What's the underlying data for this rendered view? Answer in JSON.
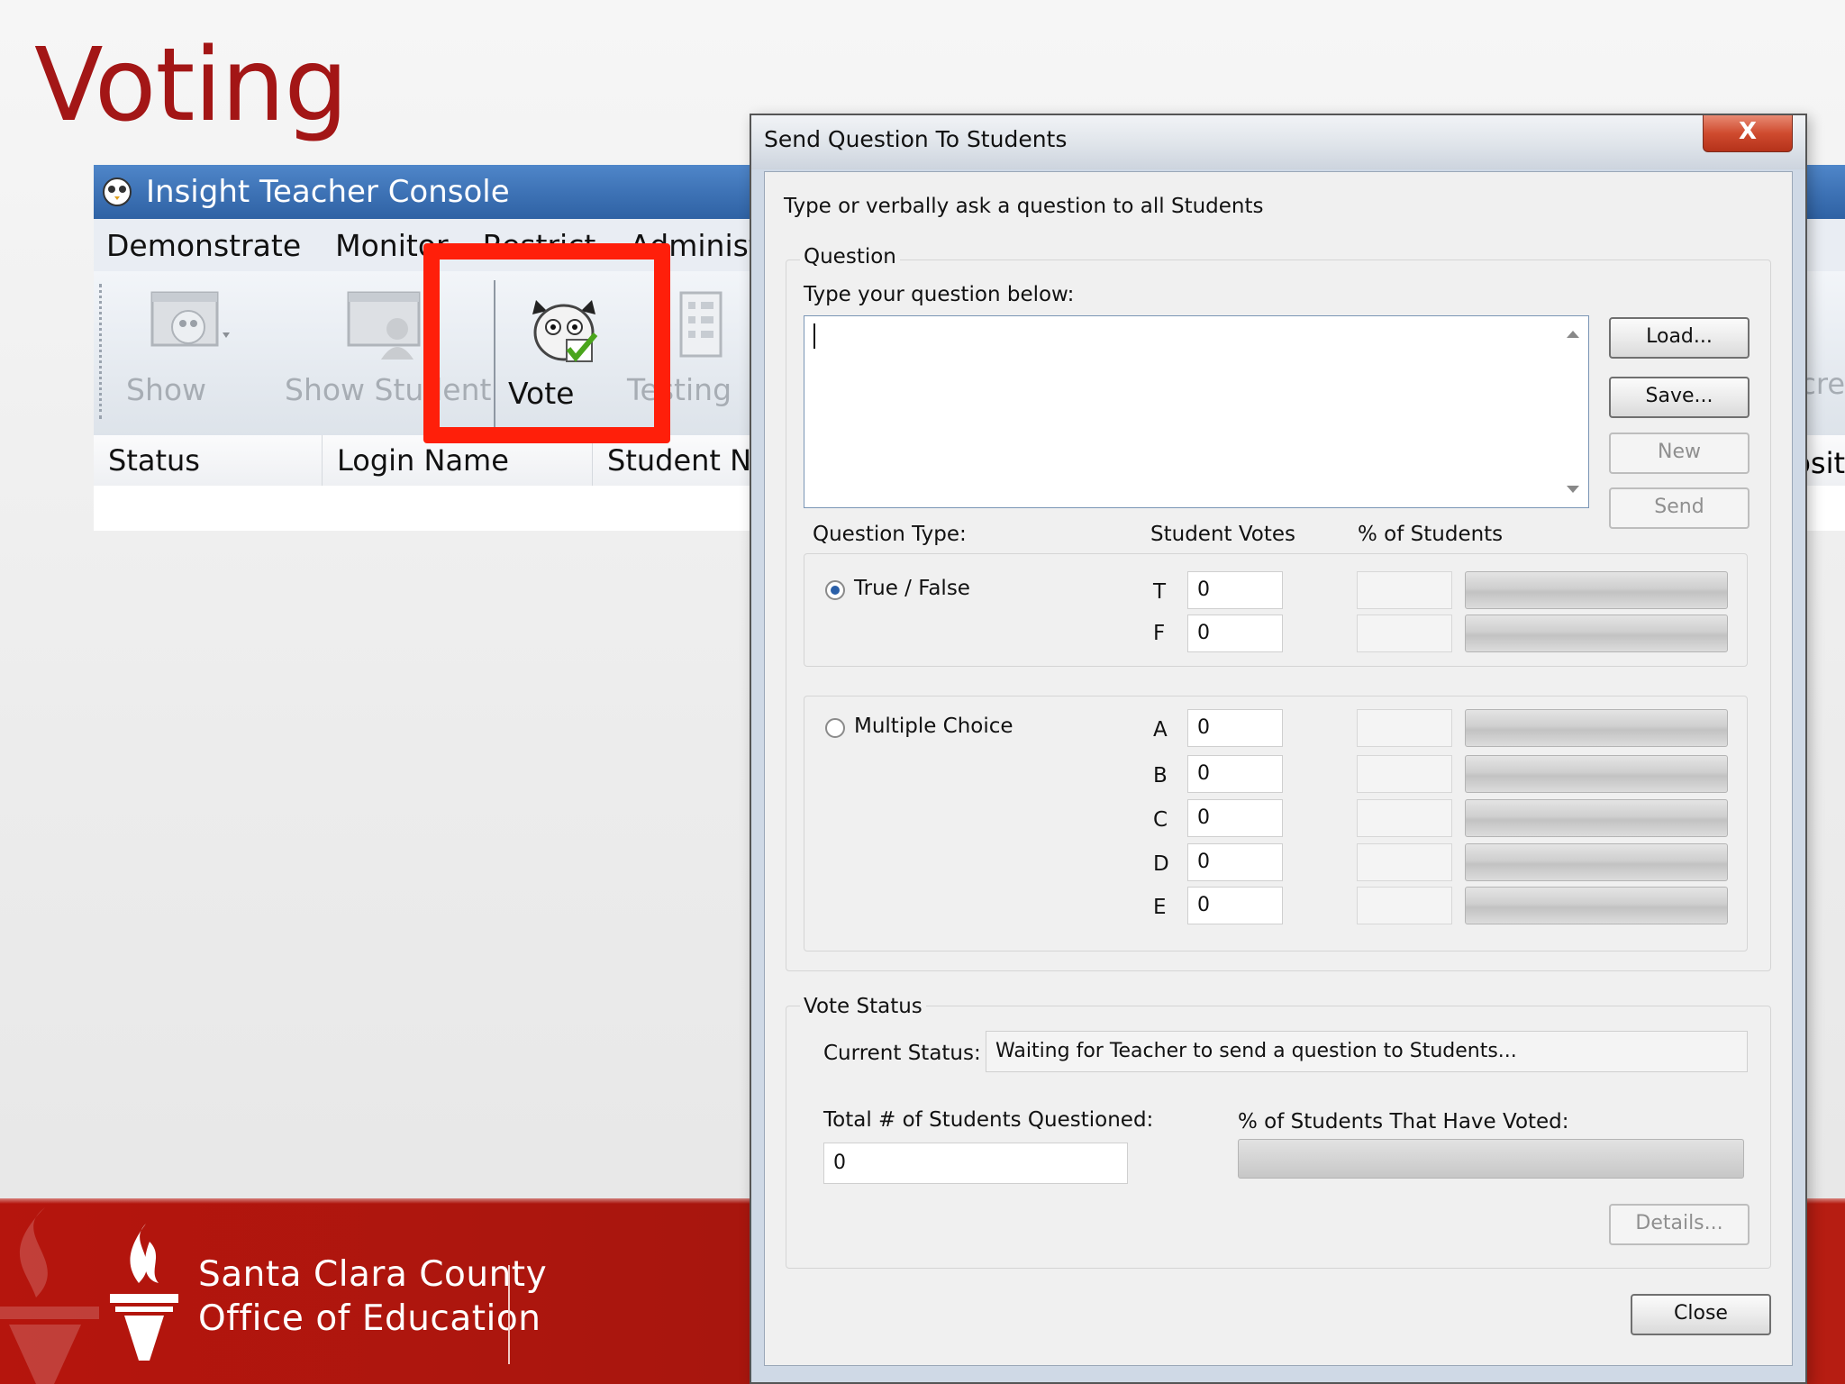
{
  "slide": {
    "title": "Voting"
  },
  "console": {
    "title": "Insight Teacher Console",
    "menu": [
      "Demonstrate",
      "Monitor",
      "Restrict",
      "Administer"
    ],
    "toolbar": [
      {
        "label": "Show",
        "icon": "owl-screen-icon",
        "state": "disabled"
      },
      {
        "label": "Show Student",
        "icon": "student-screen-icon",
        "state": "disabled"
      },
      {
        "label": "Vote",
        "icon": "owl-vote-icon",
        "state": "active"
      },
      {
        "label": "Testing",
        "icon": "test-sheet-icon",
        "state": "disabled"
      }
    ],
    "columns": [
      "Status",
      "Login Name",
      "Student N"
    ],
    "right_partial": {
      "toolbar": "cre",
      "column": "osit"
    }
  },
  "dialog": {
    "title": "Send Question To Students",
    "close_glyph": "X",
    "instruction": "Type or verbally ask a question to all Students",
    "question_group": "Question",
    "question_prompt": "Type your question below:",
    "question_value": "",
    "buttons": {
      "load": "Load...",
      "save": "Save...",
      "new": "New",
      "send": "Send",
      "details": "Details...",
      "close": "Close"
    },
    "headers": {
      "type": "Question Type:",
      "votes": "Student Votes",
      "percent": "% of Students"
    },
    "true_false": {
      "label": "True / False",
      "selected": true,
      "rows": [
        {
          "key": "T",
          "votes": "0"
        },
        {
          "key": "F",
          "votes": "0"
        }
      ]
    },
    "multiple_choice": {
      "label": "Multiple Choice",
      "selected": false,
      "rows": [
        {
          "key": "A",
          "votes": "0"
        },
        {
          "key": "B",
          "votes": "0"
        },
        {
          "key": "C",
          "votes": "0"
        },
        {
          "key": "D",
          "votes": "0"
        },
        {
          "key": "E",
          "votes": "0"
        }
      ]
    },
    "vote_status": {
      "group": "Vote Status",
      "current_label": "Current Status:",
      "current_value": "Waiting for Teacher to send a question to Students...",
      "total_label": "Total # of Students Questioned:",
      "total_value": "0",
      "voted_label": "% of  Students That Have Voted:",
      "voted_fraction": 0
    }
  },
  "footer": {
    "line1": "Santa Clara County",
    "line2": "Office of Education"
  },
  "colors": {
    "title_red": "#a31616",
    "highlight": "#ff1f0a",
    "footer_red": "#b5150d",
    "console_blue": "#3e73b6"
  }
}
